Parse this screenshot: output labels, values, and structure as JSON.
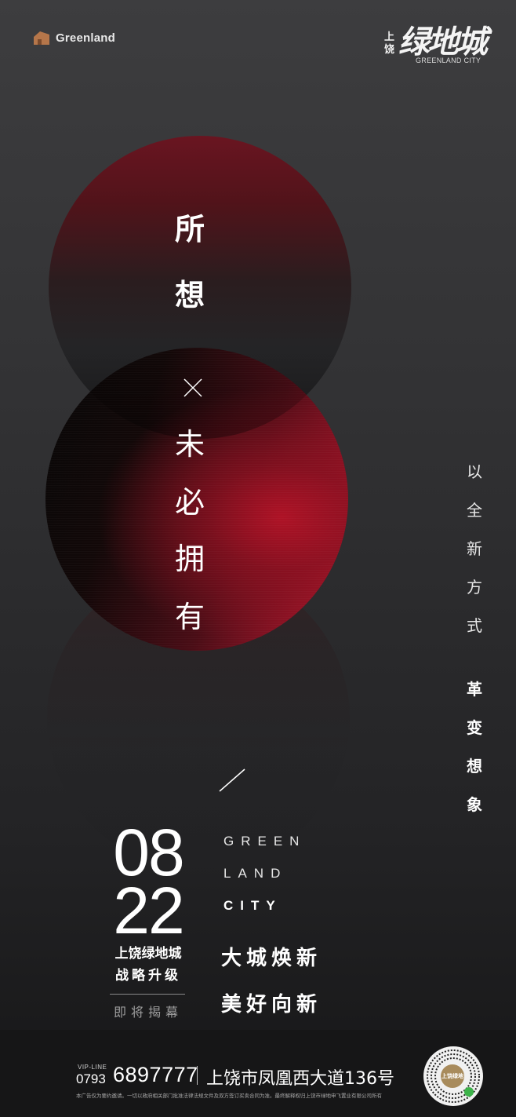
{
  "header": {
    "left_logo_text": "Greenland",
    "right_logo_prefix": "上饶",
    "right_logo_main": "绿地城",
    "right_logo_sub": "GREENLAND CITY"
  },
  "hero": {
    "line1": [
      "所",
      "想"
    ],
    "line2": [
      "未",
      "必",
      "拥",
      "有"
    ]
  },
  "side_copy": {
    "light": [
      "以",
      "全",
      "新",
      "方",
      "式"
    ],
    "bold": [
      "革",
      "变",
      "想",
      "象"
    ]
  },
  "event": {
    "month": "08",
    "day": "22",
    "line1": "上饶绿地城",
    "line2": "战略升级",
    "status": "即将揭幕"
  },
  "brand_lines": [
    "GREEN",
    "LAND",
    "CITY"
  ],
  "slogans": [
    "大城焕新",
    "美好向新"
  ],
  "footer": {
    "vip_label": "VIP-LINE",
    "area_code": "0793",
    "phone": "6897777",
    "address": "上饶市凤凰西大道136号",
    "disclaimer": "本广告仅为要约邀请。一切以政府相关部门批准法律法规文件及双方签订买卖合同为准。最终解释权归上饶市绿地申飞置业有限公司所有",
    "qr_label": "上饶绿地"
  },
  "colors": {
    "accent_red": "#b01830",
    "background": "#2c2c2e",
    "logo_brown": "#b5764a"
  }
}
